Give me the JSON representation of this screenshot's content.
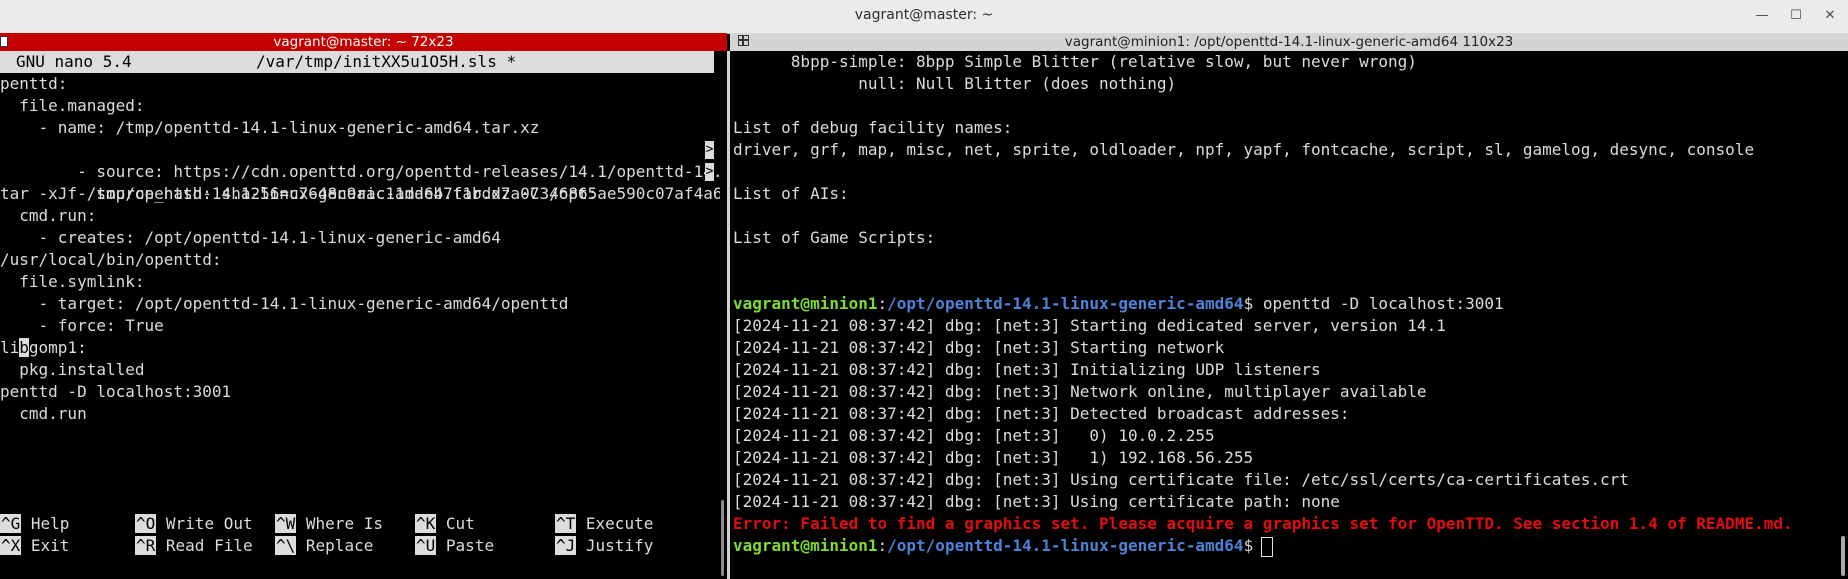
{
  "window": {
    "title": "vagrant@master: ~",
    "min_icon": "—",
    "max_icon": "☐",
    "close_icon": "✕"
  },
  "left_pane": {
    "header": "vagrant@master: ~ 72x23",
    "nano_version": "GNU nano 5.4",
    "file_name": "/var/tmp/initXX5u1O5H.sls *",
    "lines": [
      "penttd:",
      "  file.managed:",
      "    - name: /tmp/openttd-14.1-linux-generic-amd64.tar.xz",
      "    - source: https://cdn.openttd.org/openttd-releases/14.1/openttd-14.",
      "    - source_hash: sha256=c7648c9aac11daeb7f1bdd7a07346865ae590c07af4a6",
      "tar -xJf /tmp/openttd-14.1-linux-generic-amd64.tar.xz -C /opt:",
      "  cmd.run:",
      "    - creates: /opt/openttd-14.1-linux-generic-amd64",
      "/usr/local/bin/openttd:",
      "  file.symlink:",
      "    - target: /opt/openttd-14.1-linux-generic-amd64/openttd",
      "    - force: True",
      "gomp1:",
      "  pkg.installed",
      "penttd -D localhost:3001",
      "  cmd.run"
    ],
    "cursor_line_prefix": "li",
    "cursor_char": "b",
    "overflow_marker": ">",
    "shortcuts": [
      {
        "key": "^G",
        "label": "Help"
      },
      {
        "key": "^O",
        "label": "Write Out"
      },
      {
        "key": "^W",
        "label": "Where Is"
      },
      {
        "key": "^K",
        "label": "Cut"
      },
      {
        "key": "^T",
        "label": "Execute"
      },
      {
        "key": "^X",
        "label": "Exit"
      },
      {
        "key": "^R",
        "label": "Read File"
      },
      {
        "key": "^\\",
        "label": "Replace"
      },
      {
        "key": "^U",
        "label": "Paste"
      },
      {
        "key": "^J",
        "label": "Justify"
      }
    ]
  },
  "right_pane": {
    "header": "vagrant@minion1: /opt/openttd-14.1-linux-generic-amd64 110x23",
    "lines": [
      "      8bpp-simple: 8bpp Simple Blitter (relative slow, but never wrong)",
      "             null: Null Blitter (does nothing)",
      "",
      "List of debug facility names:",
      "driver, grf, map, misc, net, sprite, oldloader, npf, yapf, fontcache, script, sl, gamelog, desync, console",
      "",
      "List of AIs:",
      "",
      "List of Game Scripts:",
      "",
      ""
    ],
    "prompt_user": "vagrant@minion1",
    "prompt_sep": ":",
    "prompt_path": "/opt/openttd-14.1-linux-generic-amd64",
    "prompt_dollar": "$",
    "command": " openttd -D localhost:3001",
    "log_lines": [
      "[2024-11-21 08:37:42] dbg: [net:3] Starting dedicated server, version 14.1",
      "[2024-11-21 08:37:42] dbg: [net:3] Starting network",
      "[2024-11-21 08:37:42] dbg: [net:3] Initializing UDP listeners",
      "[2024-11-21 08:37:42] dbg: [net:3] Network online, multiplayer available",
      "[2024-11-21 08:37:42] dbg: [net:3] Detected broadcast addresses:",
      "[2024-11-21 08:37:42] dbg: [net:3]   0) 10.0.2.255",
      "[2024-11-21 08:37:42] dbg: [net:3]   1) 192.168.56.255",
      "[2024-11-21 08:37:42] dbg: [net:3] Using certificate file: /etc/ssl/certs/ca-certificates.crt",
      "[2024-11-21 08:37:42] dbg: [net:3] Using certificate path: none"
    ],
    "error_line": "Error: Failed to find a graphics set. Please acquire a graphics set for OpenTTD. See section 1.4 of README.md."
  }
}
